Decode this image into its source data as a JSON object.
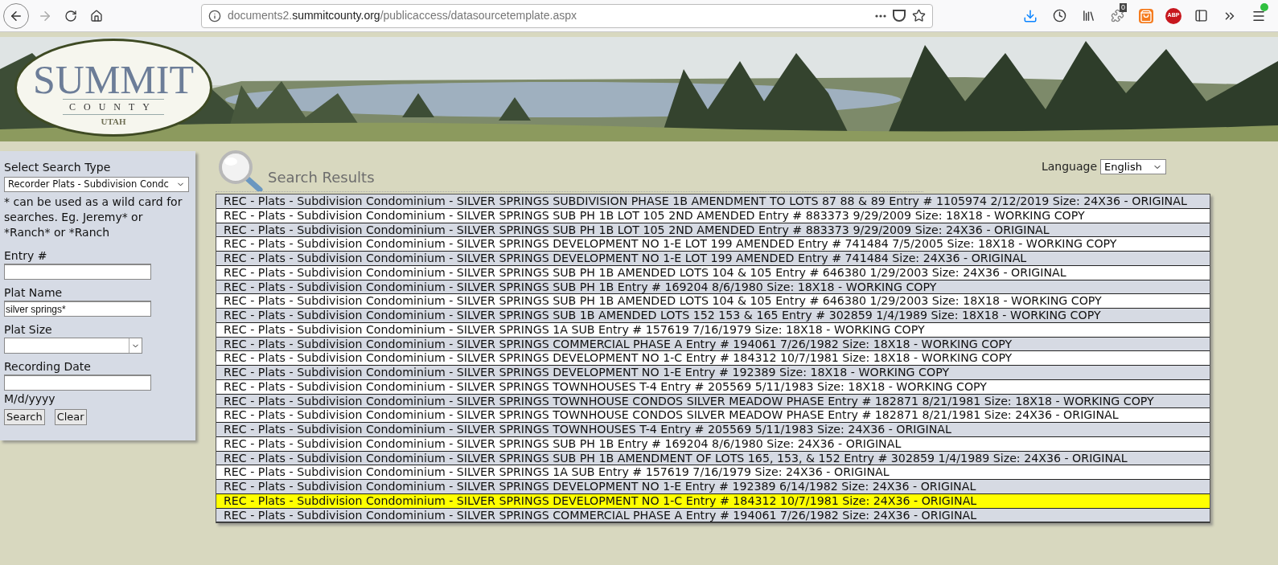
{
  "browser": {
    "url": {
      "prefix": "documents2.",
      "host": "summitcounty.org",
      "path": "/publicaccess/datasourcetemplate.aspx"
    },
    "extension_badge": "0",
    "adblock_label": "ABP"
  },
  "logo": {
    "name": "SUMMIT",
    "county": "COUNTY",
    "state": "UTAH"
  },
  "search_panel": {
    "title": "Select Search Type",
    "search_type": "Recorder Plats - Subdivision Condc",
    "hint": "* can be used as a wild card for searches. Eg. Jeremy* or *Ranch* or *Ranch",
    "fields": [
      {
        "kind": "text",
        "label": "Entry #"
      },
      {
        "kind": "text",
        "label": "Plat Name",
        "value": "silver springs*"
      },
      {
        "kind": "select",
        "label": "Plat Size"
      },
      {
        "kind": "text",
        "label": "Recording Date",
        "note": "M/d/yyyy"
      }
    ],
    "buttons": [
      "Search",
      "Clear"
    ]
  },
  "language": {
    "label": "Language",
    "value": "English"
  },
  "results": {
    "title": "Search Results",
    "rows": [
      {
        "text": "REC - Plats - Subdivision Condominium - SILVER SPRINGS SUBDIVISION PHASE 1B AMENDMENT TO LOTS 87 88 & 89 Entry # 1105974 2/12/2019 Size: 24X36 - ORIGINAL",
        "selected": false
      },
      {
        "text": "REC - Plats - Subdivision Condominium - SILVER SPRINGS SUB PH 1B LOT 105 2ND AMENDED Entry # 883373 9/29/2009 Size: 18X18 - WORKING COPY",
        "selected": false
      },
      {
        "text": "REC - Plats - Subdivision Condominium - SILVER SPRINGS SUB PH 1B LOT 105 2ND AMENDED Entry # 883373 9/29/2009 Size: 24X36 - ORIGINAL",
        "selected": false
      },
      {
        "text": "REC - Plats - Subdivision Condominium - SILVER SPRINGS DEVELOPMENT NO 1-E LOT 199 AMENDED Entry # 741484 7/5/2005 Size: 18X18 - WORKING COPY",
        "selected": false
      },
      {
        "text": "REC - Plats - Subdivision Condominium - SILVER SPRINGS DEVELOPMENT NO 1-E LOT 199 AMENDED Entry # 741484 Size: 24X36 - ORIGINAL",
        "selected": false
      },
      {
        "text": "REC - Plats - Subdivision Condominium - SILVER SPRINGS SUB PH 1B AMENDED LOTS 104 & 105 Entry # 646380 1/29/2003 Size: 24X36 - ORIGINAL",
        "selected": false
      },
      {
        "text": "REC - Plats - Subdivision Condominium - SILVER SPRINGS SUB PH 1B Entry # 169204 8/6/1980 Size: 18X18 - WORKING COPY",
        "selected": false
      },
      {
        "text": "REC - Plats - Subdivision Condominium - SILVER SPRINGS SUB PH 1B AMENDED LOTS 104 & 105 Entry # 646380 1/29/2003 Size: 18X18 - WORKING COPY",
        "selected": false
      },
      {
        "text": "REC - Plats - Subdivision Condominium - SILVER SPRINGS SUB 1B AMENDED LOTS 152 153 & 165 Entry # 302859 1/4/1989 Size: 18X18 - WORKING COPY",
        "selected": false
      },
      {
        "text": "REC - Plats - Subdivision Condominium - SILVER SPRINGS 1A SUB Entry # 157619 7/16/1979 Size: 18X18 - WORKING COPY",
        "selected": false
      },
      {
        "text": "REC - Plats - Subdivision Condominium - SILVER SPRINGS COMMERCIAL PHASE A Entry # 194061 7/26/1982 Size: 18X18 - WORKING COPY",
        "selected": false
      },
      {
        "text": "REC - Plats - Subdivision Condominium - SILVER SPRINGS DEVELOPMENT NO 1-C Entry # 184312 10/7/1981 Size: 18X18 - WORKING COPY",
        "selected": false
      },
      {
        "text": "REC - Plats - Subdivision Condominium - SILVER SPRINGS DEVELOPMENT NO 1-E Entry # 192389 Size: 18X18 - WORKING COPY",
        "selected": false
      },
      {
        "text": "REC - Plats - Subdivision Condominium - SILVER SPRINGS TOWNHOUSES T-4 Entry # 205569 5/11/1983 Size: 18X18 - WORKING COPY",
        "selected": false
      },
      {
        "text": "REC - Plats - Subdivision Condominium - SILVER SPRINGS TOWNHOUSE CONDOS SILVER MEADOW PHASE Entry # 182871 8/21/1981 Size: 18X18 - WORKING COPY",
        "selected": false
      },
      {
        "text": "REC - Plats - Subdivision Condominium - SILVER SPRINGS TOWNHOUSE CONDOS SILVER MEADOW PHASE Entry # 182871 8/21/1981 Size: 24X36 - ORIGINAL",
        "selected": false
      },
      {
        "text": "REC - Plats - Subdivision Condominium - SILVER SPRINGS TOWNHOUSES T-4 Entry # 205569 5/11/1983 Size: 24X36 - ORIGINAL",
        "selected": false
      },
      {
        "text": "REC - Plats - Subdivision Condominium - SILVER SPRINGS SUB PH 1B Entry # 169204 8/6/1980 Size: 24X36 - ORIGINAL",
        "selected": false
      },
      {
        "text": "REC - Plats - Subdivision Condominium - SILVER SPRINGS SUB PH 1B AMENDMENT OF LOTS 165, 153, & 152 Entry # 302859 1/4/1989 Size: 24X36 - ORIGINAL",
        "selected": false
      },
      {
        "text": "REC - Plats - Subdivision Condominium - SILVER SPRINGS 1A SUB Entry # 157619 7/16/1979 Size: 24X36 - ORIGINAL",
        "selected": false
      },
      {
        "text": "REC - Plats - Subdivision Condominium - SILVER SPRINGS DEVELOPMENT NO 1-E Entry # 192389 6/14/1982 Size: 24X36 - ORIGINAL",
        "selected": false
      },
      {
        "text": "REC - Plats - Subdivision Condominium - SILVER SPRINGS DEVELOPMENT NO 1-C Entry # 184312 10/7/1981 Size: 24X36 - ORIGINAL",
        "selected": true
      },
      {
        "text": "REC - Plats - Subdivision Condominium - SILVER SPRINGS COMMERCIAL PHASE A Entry # 194061 7/26/1982 Size: 24X36 - ORIGINAL",
        "selected": false
      }
    ]
  }
}
